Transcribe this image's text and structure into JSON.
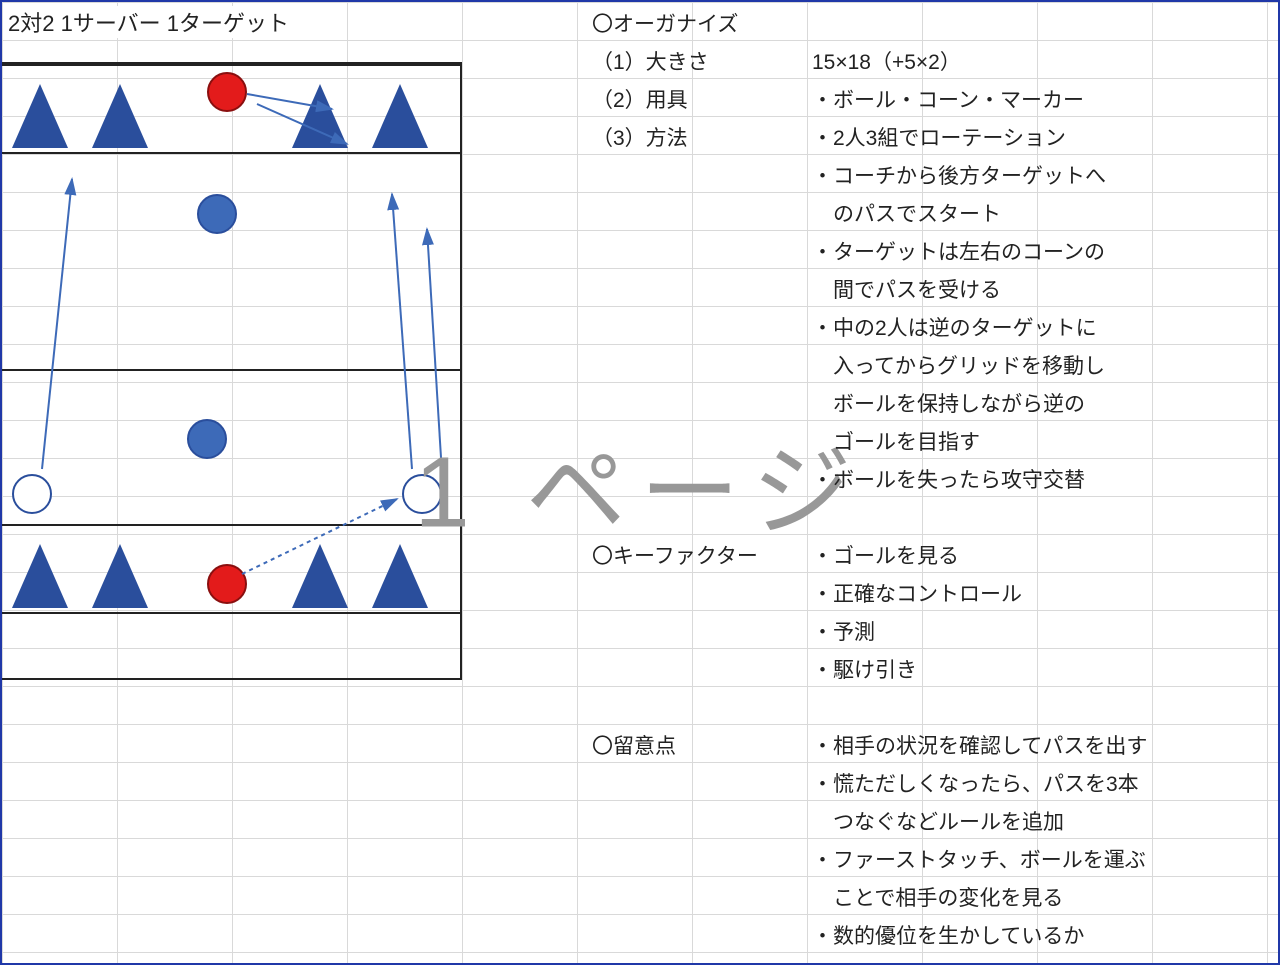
{
  "title": "2対2 1サーバー 1ターゲット",
  "watermark": "1 ページ",
  "organize": {
    "heading": "〇オーガナイズ",
    "size_label": "（1）大きさ",
    "size_value": "15×18（+5×2）",
    "equip_label": "（2）用具",
    "equip_value": "・ボール・コーン・マーカー",
    "method_label": "（3）方法",
    "method_lines": [
      "・2人3組でローテーション",
      "・コーチから後方ターゲットへ",
      "　のパスでスタート",
      "・ターゲットは左右のコーンの",
      "　間でパスを受ける",
      "・中の2人は逆のターゲットに",
      "　入ってからグリッドを移動し",
      "　ボールを保持しながら逆の",
      "　ゴールを目指す",
      "・ボールを失ったら攻守交替"
    ]
  },
  "keyfactor": {
    "heading": "〇キーファクター",
    "lines": [
      "・ゴールを見る",
      "・正確なコントロール",
      "・予測",
      "・駆け引き"
    ]
  },
  "notes": {
    "heading": "〇留意点",
    "lines": [
      "・相手の状況を確認してパスを出す",
      "・慌ただしくなったら、パスを3本",
      "　つなぐなどルールを追加",
      "・ファーストタッチ、ボールを運ぶ",
      "　ことで相手の変化を見る",
      "・数的優位を生かしているか"
    ]
  }
}
